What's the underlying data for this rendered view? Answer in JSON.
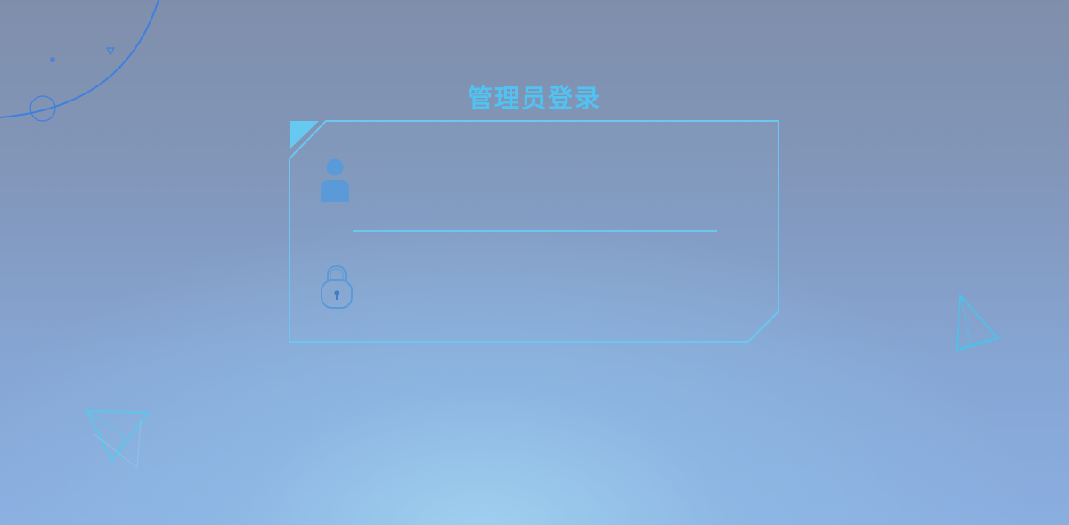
{
  "login": {
    "title": "管理员登录",
    "username": {
      "icon": "user-icon",
      "value": ""
    },
    "password": {
      "icon": "lock-icon",
      "value": ""
    }
  },
  "colors": {
    "accent": "#4fc3f2",
    "frame": "#6cc6f2",
    "icon_fill": "#5a9ad8"
  }
}
